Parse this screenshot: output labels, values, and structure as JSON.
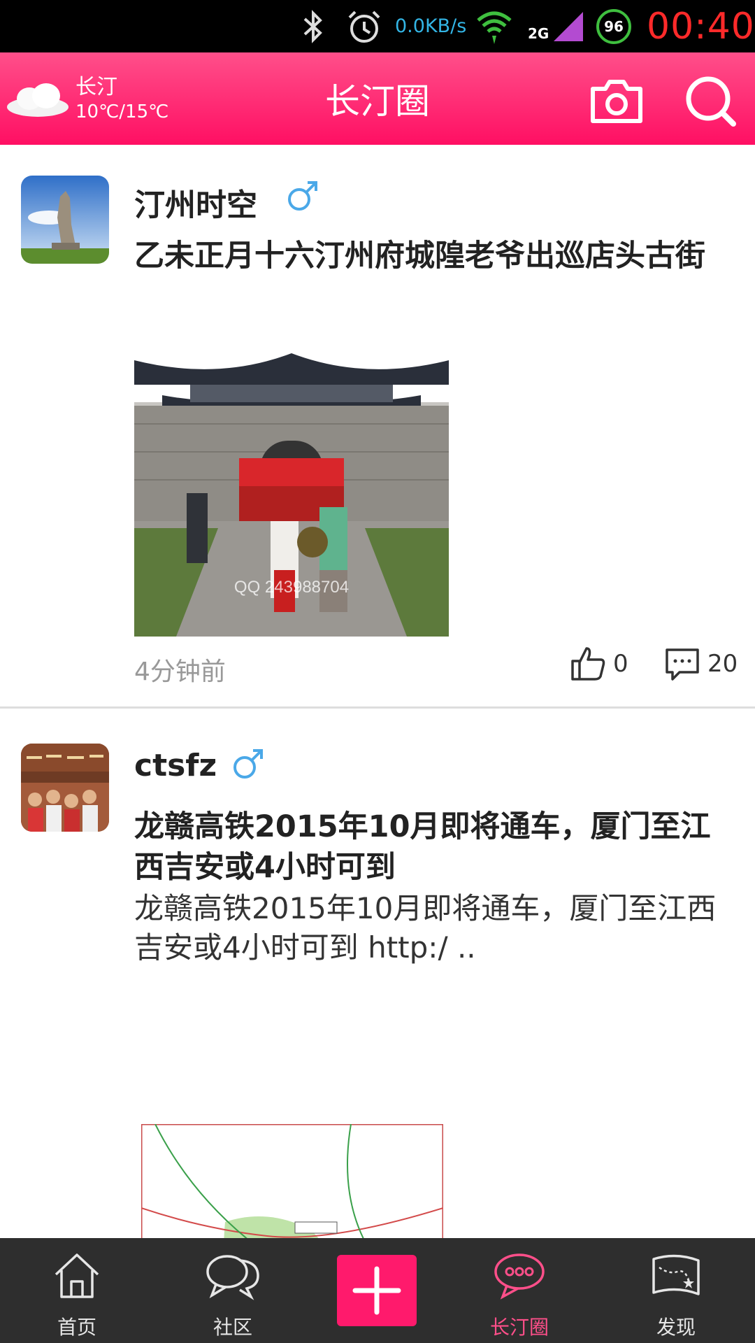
{
  "status_bar": {
    "network_speed": "0.0KB/s",
    "signal_type": "2G",
    "battery": "96",
    "time": "00:40"
  },
  "header": {
    "weather_city": "长汀",
    "weather_temp": "10℃/15℃",
    "title": "长汀圈"
  },
  "posts": [
    {
      "user": "汀州时空",
      "title": "乙未正月十六汀州府城隍老爷出巡店头古街",
      "body": "",
      "image_caption": "QQ 243988704",
      "time": "4分钟前",
      "likes": "0",
      "comments": "20"
    },
    {
      "user": "ctsfz",
      "title": "龙赣高铁2015年10月即将通车，厦门至江西吉安或4小时可到",
      "body": "龙赣高铁2015年10月即将通车，厦门至江西吉安或4小时可到 http:/ .."
    }
  ],
  "bottom_nav": {
    "items": [
      {
        "label": "首页",
        "icon": "home-icon"
      },
      {
        "label": "社区",
        "icon": "community-chat-icon"
      },
      {
        "label": "",
        "icon": "add-icon"
      },
      {
        "label": "长汀圈",
        "icon": "circle-chat-icon"
      },
      {
        "label": "发现",
        "icon": "discover-map-icon"
      }
    ],
    "active_index": 3
  },
  "colors": {
    "brand_pink": "#ff1a6c",
    "status_clock": "#ff2a2a",
    "gender_male": "#4aa8e8"
  }
}
